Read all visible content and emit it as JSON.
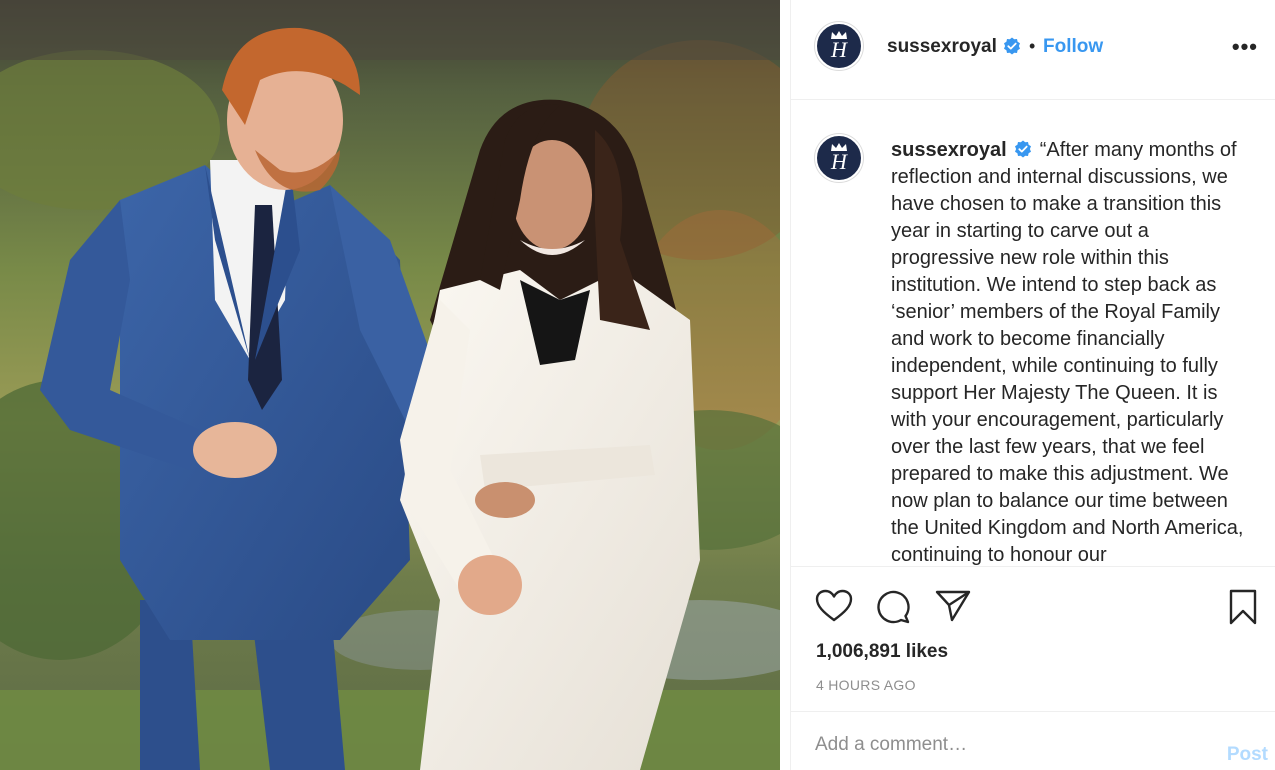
{
  "post": {
    "image_alt": "Couple walking hand in hand in a garden"
  },
  "header": {
    "username": "sussexroyal",
    "avatar_monogram": "H",
    "separator": "•",
    "follow_label": "Follow",
    "more_label": "•••"
  },
  "caption": {
    "username": "sussexroyal",
    "text": "“After many months of reflection and internal discussions, we have chosen to make a transition this year in starting to carve out a progressive new role within this institution. We intend to step back as ‘senior’ members of the Royal Family and work to become financially independent, while continuing to fully support Her Majesty The Queen. It is with your encouragement, particularly over the last few years, that we feel prepared to make this adjustment. We now plan to balance our time between the United Kingdom and North America, continuing to honour our"
  },
  "actions": {
    "icons": [
      "heart-icon",
      "comment-icon",
      "share-icon",
      "bookmark-icon"
    ],
    "likes": "1,006,891 likes",
    "time_ago": "4 HOURS AGO"
  },
  "comment": {
    "placeholder": "Add a comment…",
    "post_label": "Post"
  },
  "colors": {
    "link_blue": "#3897f0",
    "verified_blue": "#3897f0",
    "avatar_navy": "#1d2a4a",
    "post_disabled": "#b3dbff",
    "muted": "#8e8e8e"
  }
}
